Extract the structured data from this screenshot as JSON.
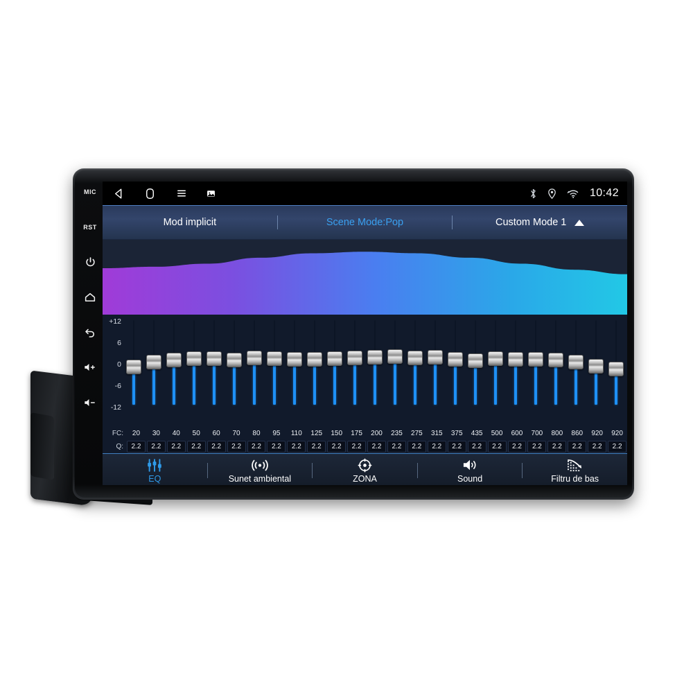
{
  "device": {
    "side_buttons": [
      {
        "name": "mic-button",
        "label": "MIC",
        "type": "text"
      },
      {
        "name": "reset-button",
        "label": "RST",
        "type": "text"
      },
      {
        "name": "power-button",
        "label": "power-icon",
        "type": "icon"
      },
      {
        "name": "home-button",
        "label": "home-icon",
        "type": "icon"
      },
      {
        "name": "back-button",
        "label": "back-icon",
        "type": "icon"
      },
      {
        "name": "volume-up-button",
        "label": "volume-up-icon",
        "type": "icon"
      },
      {
        "name": "volume-down-button",
        "label": "volume-down-icon",
        "type": "icon"
      }
    ]
  },
  "statusbar": {
    "nav": [
      {
        "name": "nav-back-icon",
        "label": "back-triangle-icon"
      },
      {
        "name": "nav-home-icon",
        "label": "home-square-icon"
      },
      {
        "name": "nav-menu-icon",
        "label": "menu-lines-icon"
      },
      {
        "name": "nav-screenshot-icon",
        "label": "screenshot-icon"
      }
    ],
    "indicators": [
      {
        "name": "bluetooth-icon",
        "label": "bluetooth-icon"
      },
      {
        "name": "location-icon",
        "label": "location-pin-icon"
      },
      {
        "name": "wifi-icon",
        "label": "wifi-icon"
      }
    ],
    "clock": "10:42"
  },
  "modebar": {
    "default_mode": "Mod implicit",
    "scene_mode": "Scene Mode:Pop",
    "custom_mode": "Custom Mode 1",
    "active_index": 1,
    "accent": "#3aa0f0"
  },
  "chart_data": {
    "type": "area",
    "title": "",
    "xlabel": "",
    "ylabel": "",
    "description": "EQ response curve, purple-to-cyan gradient fill",
    "gradient_stops": [
      "#a03bd8",
      "#7b4fe0",
      "#4a7ef0",
      "#2aa8e8",
      "#22c8e6"
    ],
    "x": [
      0,
      10,
      20,
      30,
      40,
      50,
      60,
      70,
      80,
      90,
      100
    ],
    "y": [
      62,
      64,
      68,
      76,
      82,
      84,
      82,
      76,
      68,
      60,
      54
    ]
  },
  "equalizer": {
    "axis_labels": [
      "+12",
      "6",
      "0",
      "-6",
      "-12"
    ],
    "axis_max": 12,
    "axis_min": -12,
    "fc_label": "FC:",
    "q_label": "Q:",
    "bands": [
      {
        "fc": "20",
        "q": "2.2",
        "gain": -1.0
      },
      {
        "fc": "30",
        "q": "2.2",
        "gain": 0.2
      },
      {
        "fc": "40",
        "q": "2.2",
        "gain": 0.8
      },
      {
        "fc": "50",
        "q": "2.2",
        "gain": 1.3
      },
      {
        "fc": "60",
        "q": "2.2",
        "gain": 1.3
      },
      {
        "fc": "70",
        "q": "2.2",
        "gain": 0.9
      },
      {
        "fc": "80",
        "q": "2.2",
        "gain": 1.5
      },
      {
        "fc": "95",
        "q": "2.2",
        "gain": 1.2
      },
      {
        "fc": "110",
        "q": "2.2",
        "gain": 1.0
      },
      {
        "fc": "125",
        "q": "2.2",
        "gain": 1.1
      },
      {
        "fc": "150",
        "q": "2.2",
        "gain": 1.3
      },
      {
        "fc": "175",
        "q": "2.2",
        "gain": 1.4
      },
      {
        "fc": "200",
        "q": "2.2",
        "gain": 1.6
      },
      {
        "fc": "235",
        "q": "2.2",
        "gain": 1.9
      },
      {
        "fc": "275",
        "q": "2.2",
        "gain": 1.5
      },
      {
        "fc": "315",
        "q": "2.2",
        "gain": 1.6
      },
      {
        "fc": "375",
        "q": "2.2",
        "gain": 1.0
      },
      {
        "fc": "435",
        "q": "2.2",
        "gain": 0.7
      },
      {
        "fc": "500",
        "q": "2.2",
        "gain": 1.2
      },
      {
        "fc": "600",
        "q": "2.2",
        "gain": 1.1
      },
      {
        "fc": "700",
        "q": "2.2",
        "gain": 1.0
      },
      {
        "fc": "800",
        "q": "2.2",
        "gain": 0.9
      },
      {
        "fc": "860",
        "q": "2.2",
        "gain": 0.2
      },
      {
        "fc": "920",
        "q": "2.2",
        "gain": -0.9
      },
      {
        "fc": "920",
        "q": "2.2",
        "gain": -1.6
      }
    ]
  },
  "tabs": [
    {
      "name": "tab-eq",
      "label": "EQ",
      "icon": "sliders-icon",
      "active": true
    },
    {
      "name": "tab-ambient-sound",
      "label": "Sunet ambiental",
      "icon": "waves-icon",
      "active": false
    },
    {
      "name": "tab-zone",
      "label": "ZONA",
      "icon": "target-icon",
      "active": false
    },
    {
      "name": "tab-sound",
      "label": "Sound",
      "icon": "speaker-icon",
      "active": false
    },
    {
      "name": "tab-bass-filter",
      "label": "Filtru de bas",
      "icon": "bass-curve-icon",
      "active": false
    }
  ]
}
